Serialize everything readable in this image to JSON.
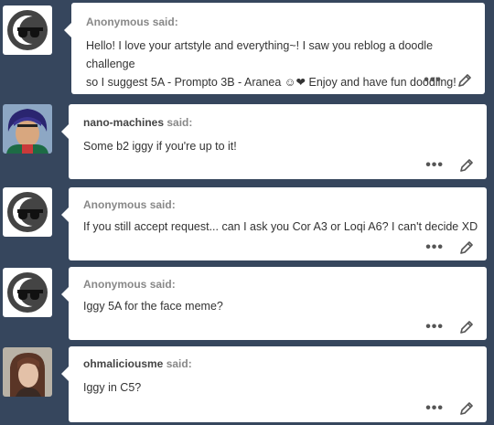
{
  "asks": [
    {
      "asker": "Anonymous",
      "said": "said:",
      "message_lines": [
        "Hello! I love your artstyle and everything~! I saw you reblog a doodle challenge",
        "so I suggest 5A - Prompto 3B - Aranea ☺❤ Enjoy and have fun doodling!"
      ],
      "avatar": "anonymous-sunglasses-avatar"
    },
    {
      "asker": "nano-machines",
      "said": "said:",
      "message_lines": [
        "Some b2 iggy if you're up to it!"
      ],
      "avatar": "purple-hair-character-avatar"
    },
    {
      "asker": "Anonymous",
      "said": "said:",
      "message_lines": [
        "If you still accept request... can I ask you Cor A3 or Loqi A6? I can't decide XD"
      ],
      "avatar": "anonymous-sunglasses-avatar"
    },
    {
      "asker": "Anonymous",
      "said": "said:",
      "message_lines": [
        "Iggy 5A for the face meme?"
      ],
      "avatar": "anonymous-sunglasses-avatar"
    },
    {
      "asker": "ohmaliciousme",
      "said": "said:",
      "message_lines": [
        "Iggy in C5?"
      ],
      "avatar": "brown-hair-photo-avatar"
    }
  ],
  "actions": {
    "more": "•••",
    "more_icon": "ellipsis-icon",
    "edit_icon": "pencil-icon"
  },
  "colors": {
    "background": "#36465d",
    "card": "#ffffff",
    "asker": "#444444",
    "said": "#888888"
  }
}
